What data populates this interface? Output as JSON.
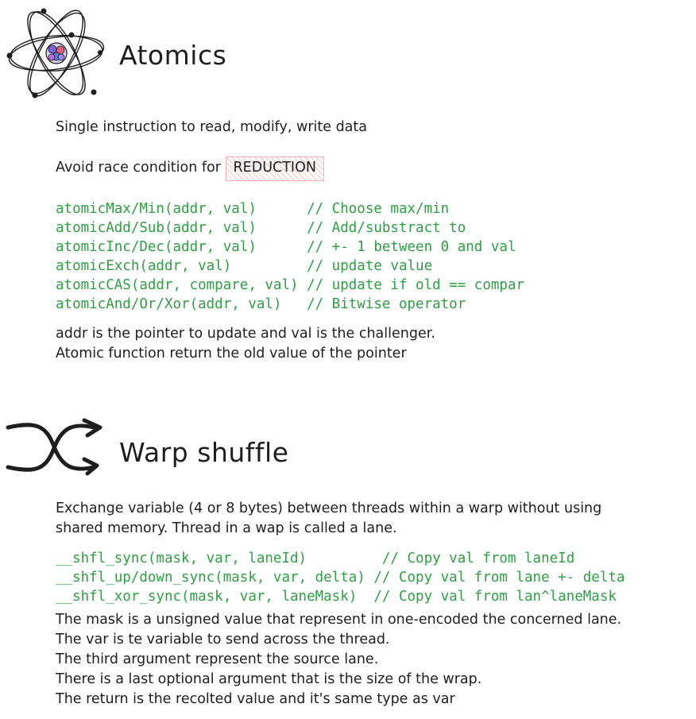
{
  "atomics": {
    "title": "Atomics",
    "line1": "Single instruction to read, modify, write data",
    "line2_prefix": "Avoid race condition for ",
    "highlight": "REDUCTION",
    "code_lines": [
      "atomicMax/Min(addr, val)      // Choose max/min",
      "atomicAdd/Sub(addr, val)      // Add/substract to",
      "atomicInc/Dec(addr, val)      // +- 1 between 0 and val",
      "atomicExch(addr, val)         // update value",
      "atomicCAS(addr, compare, val) // update if old == compar",
      "atomicAnd/Or/Xor(addr, val)   // Bitwise operator"
    ],
    "note1": "addr is the pointer to update and val is the challenger.",
    "note2": "Atomic function return the old value of the pointer"
  },
  "warp": {
    "title": "Warp shuffle",
    "desc1": "Exchange variable (4 or 8 bytes) between threads within a warp without using",
    "desc2": "shared memory. Thread in a wap is called a lane.",
    "code_lines": [
      "__shfl_sync(mask, var, laneId)         // Copy val from laneId",
      "__shfl_up/down_sync(mask, var, delta) // Copy val from lane +- delta",
      "__shfl_xor_sync(mask, var, laneMask)  // Copy val from lan^laneMask"
    ],
    "notes": [
      "The mask is a unsigned value that represent in one-encoded the concerned lane.",
      "The var is te variable to send across the thread.",
      "The third argument represent the source lane.",
      "There is a last optional argument that is the size of the wrap.",
      "The return is the recolted value and it's same type as var"
    ]
  },
  "colors": {
    "text": "#1e1e1e",
    "code": "#2f9e44",
    "highlight_hatch": "#e03131",
    "atom_nucleus": "#6c5ce7"
  },
  "icons": [
    "atom-icon",
    "shuffle-arrows-icon"
  ]
}
